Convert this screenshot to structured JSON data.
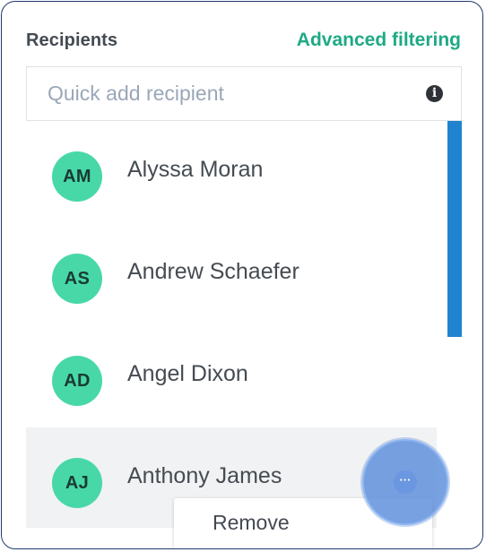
{
  "header": {
    "title": "Recipients",
    "advanced_link": "Advanced filtering"
  },
  "quick_add": {
    "placeholder": "Quick add recipient",
    "info_icon": "info-icon"
  },
  "recipients": [
    {
      "initials": "AM",
      "name": "Alyssa Moran"
    },
    {
      "initials": "AS",
      "name": "Andrew Schaefer"
    },
    {
      "initials": "AD",
      "name": "Angel Dixon"
    },
    {
      "initials": "AJ",
      "name": "Anthony James"
    }
  ],
  "context_menu": {
    "remove_label": "Remove"
  },
  "more_button": {
    "glyph": "···",
    "icon": "more-icon"
  },
  "colors": {
    "accent_green": "#1eaa84",
    "avatar_green": "#48d8a8",
    "scrollbar_blue": "#1f83d0",
    "border_navy": "#1f3b6b"
  }
}
